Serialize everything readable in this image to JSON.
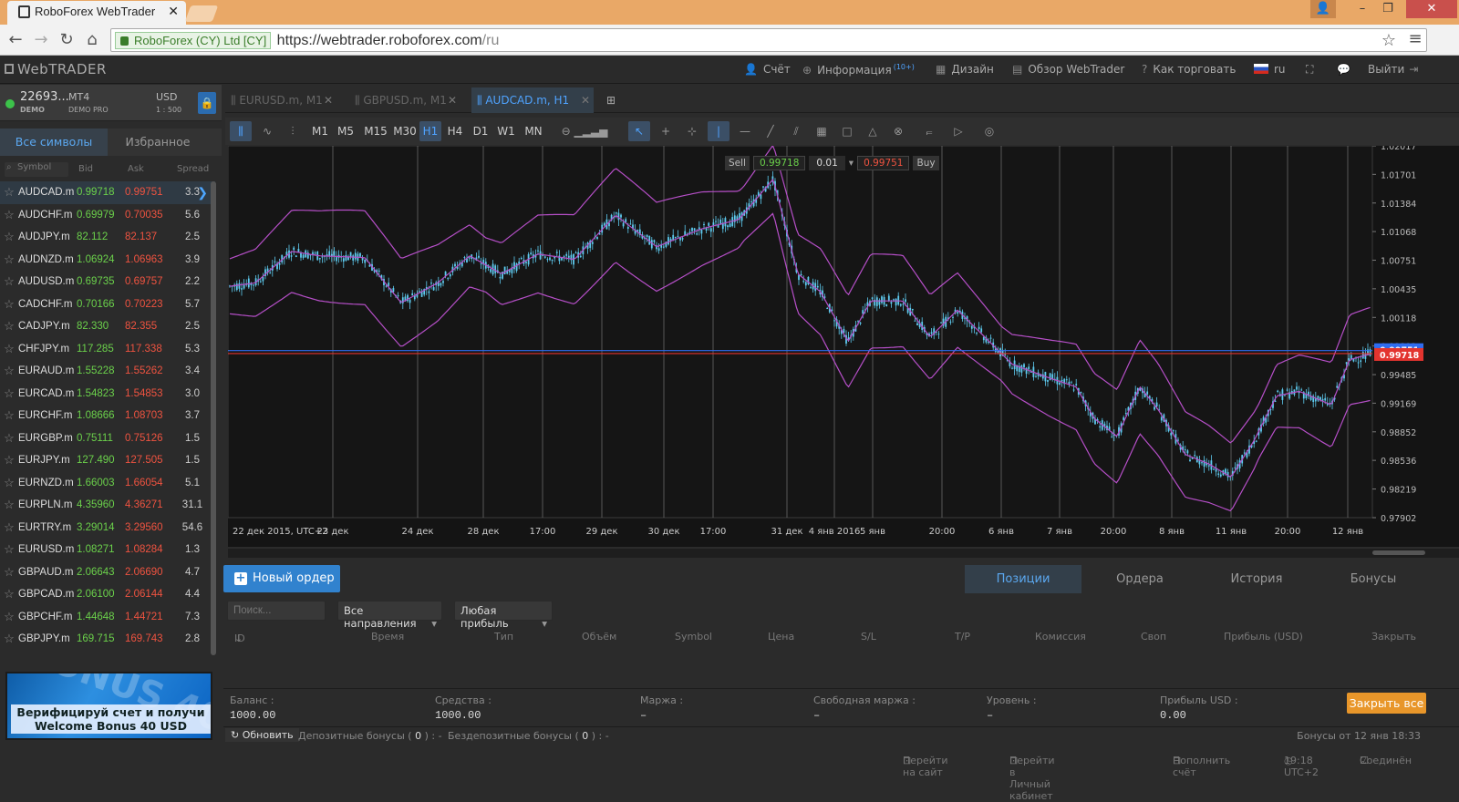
{
  "browser": {
    "tab_title": "RoboForex WebTrader",
    "ev_label": "RoboForex (CY) Ltd [CY]",
    "url_host": "https://webtrader.roboforex.com",
    "url_path": "/ru"
  },
  "header": {
    "logo": "WebTRADER",
    "account": "Счёт",
    "info": "Информация",
    "info_badge": "(10+)",
    "design": "Дизайн",
    "overview": "Обзор WebTrader",
    "how_to_trade": "Как торговать",
    "language": "ru",
    "logout": "Выйти"
  },
  "account": {
    "number": "22693...",
    "type": "DEMO",
    "platform": "MT4",
    "plan": "DEMO PRO",
    "currency": "USD",
    "leverage": "1 : 500"
  },
  "sidebar": {
    "tab_all": "Все символы",
    "tab_fav": "Избранное",
    "col_symbol": "Symbol",
    "col_bid": "Bid",
    "col_ask": "Ask",
    "col_spread": "Spread",
    "symbols": [
      {
        "name": "AUDCAD.m",
        "bid": "0.99718",
        "ask": "0.99751",
        "spread": "3.3"
      },
      {
        "name": "AUDCHF.m",
        "bid": "0.69979",
        "ask": "0.70035",
        "spread": "5.6"
      },
      {
        "name": "AUDJPY.m",
        "bid": "82.112",
        "ask": "82.137",
        "spread": "2.5"
      },
      {
        "name": "AUDNZD.m",
        "bid": "1.06924",
        "ask": "1.06963",
        "spread": "3.9"
      },
      {
        "name": "AUDUSD.m",
        "bid": "0.69735",
        "ask": "0.69757",
        "spread": "2.2"
      },
      {
        "name": "CADCHF.m",
        "bid": "0.70166",
        "ask": "0.70223",
        "spread": "5.7"
      },
      {
        "name": "CADJPY.m",
        "bid": "82.330",
        "ask": "82.355",
        "spread": "2.5"
      },
      {
        "name": "CHFJPY.m",
        "bid": "117.285",
        "ask": "117.338",
        "spread": "5.3"
      },
      {
        "name": "EURAUD.m",
        "bid": "1.55228",
        "ask": "1.55262",
        "spread": "3.4"
      },
      {
        "name": "EURCAD.m",
        "bid": "1.54823",
        "ask": "1.54853",
        "spread": "3.0"
      },
      {
        "name": "EURCHF.m",
        "bid": "1.08666",
        "ask": "1.08703",
        "spread": "3.7"
      },
      {
        "name": "EURGBP.m",
        "bid": "0.75111",
        "ask": "0.75126",
        "spread": "1.5"
      },
      {
        "name": "EURJPY.m",
        "bid": "127.490",
        "ask": "127.505",
        "spread": "1.5"
      },
      {
        "name": "EURNZD.m",
        "bid": "1.66003",
        "ask": "1.66054",
        "spread": "5.1"
      },
      {
        "name": "EURPLN.m",
        "bid": "4.35960",
        "ask": "4.36271",
        "spread": "31.1"
      },
      {
        "name": "EURTRY.m",
        "bid": "3.29014",
        "ask": "3.29560",
        "spread": "54.6"
      },
      {
        "name": "EURUSD.m",
        "bid": "1.08271",
        "ask": "1.08284",
        "spread": "1.3"
      },
      {
        "name": "GBPAUD.m",
        "bid": "2.06643",
        "ask": "2.06690",
        "spread": "4.7"
      },
      {
        "name": "GBPCAD.m",
        "bid": "2.06100",
        "ask": "2.06144",
        "spread": "4.4"
      },
      {
        "name": "GBPCHF.m",
        "bid": "1.44648",
        "ask": "1.44721",
        "spread": "7.3"
      },
      {
        "name": "GBPJPY.m",
        "bid": "169.715",
        "ask": "169.743",
        "spread": "2.8"
      }
    ],
    "promo_line1": "Верифицируй счет и получи",
    "promo_line2": "Welcome Bonus 40 USD"
  },
  "chart_tabs": [
    {
      "label": "EURUSD.m, M1"
    },
    {
      "label": "GBPUSD.m, M1"
    },
    {
      "label": "AUDCAD.m, H1"
    }
  ],
  "toolbar": {
    "timeframes": [
      "M1",
      "M5",
      "M15",
      "M30",
      "H1",
      "H4",
      "D1",
      "W1",
      "MN"
    ],
    "active_timeframe": "H1"
  },
  "trade_panel": {
    "sell_label": "Sell",
    "sell_price": "0.99718",
    "volume": "0.01",
    "buy_price": "0.99751",
    "buy_label": "Buy"
  },
  "chart_data": {
    "type": "candlestick",
    "symbol": "AUDCAD.m, H1",
    "y_ticks": [
      "1.02017",
      "1.01701",
      "1.01384",
      "1.01068",
      "1.00751",
      "1.00435",
      "1.00118",
      "0.99802",
      "0.99485",
      "0.99169",
      "0.98852",
      "0.98536",
      "0.98219",
      "0.97902"
    ],
    "ylim": [
      0.97902,
      1.02017
    ],
    "x_ticks": [
      "22 дек 2015, UTC+2",
      "23 дек",
      "24 дек",
      "28 дек",
      "17:00",
      "29 дек",
      "30 дек",
      "17:00",
      "31 дек",
      "4 янв 2016",
      "5 янв",
      "20:00",
      "6 янв",
      "7 янв",
      "20:00",
      "8 янв",
      "11 янв",
      "20:00",
      "12 янв"
    ],
    "ask_line": "0.99751",
    "bid_line": "0.99718",
    "indicator": "Bollinger Bands",
    "colors": {
      "candle": "#5ecbf0",
      "bands": "#b64fc8",
      "ask": "#2f6cf0",
      "bid": "#e3342f",
      "background": "#141414"
    }
  },
  "bottom": {
    "new_order": "Новый ордер",
    "tabs": [
      "Позиции",
      "Ордера",
      "История",
      "Бонусы"
    ],
    "search_placeholder": "Поиск...",
    "direction": "Все направления",
    "profit_filter": "Любая прибыль",
    "columns": [
      "ID",
      "Время",
      "Тип",
      "Объём",
      "Symbol",
      "Цена",
      "S/L",
      "T/P",
      "Комиссия",
      "Своп",
      "Прибыль (USD)",
      "Закрыть"
    ],
    "balance_label": "Баланс :",
    "balance": "1000.00",
    "equity_label": "Средства :",
    "equity": "1000.00",
    "margin_label": "Маржа :",
    "margin": "–",
    "free_margin_label": "Свободная маржа :",
    "free_margin": "–",
    "level_label": "Уровень :",
    "level": "–",
    "profit_label": "Прибыль USD :",
    "profit": "0.00",
    "close_all": "Закрыть все",
    "refresh": "Обновить",
    "deposit_bonuses": "Депозитные бонусы",
    "deposit_bonuses_count": "0",
    "no_deposit_bonuses": "Бездепозитные бонусы",
    "no_deposit_bonuses_count": "0",
    "bonus_time": "Бонусы  от 12 янв 18:33"
  },
  "footer": {
    "go_site": "Перейти на сайт",
    "go_cabinet": "Перейти в Личный кабинет",
    "deposit": "Пополнить счёт",
    "time": "19:18 UTC+2",
    "status": "Соединён"
  }
}
